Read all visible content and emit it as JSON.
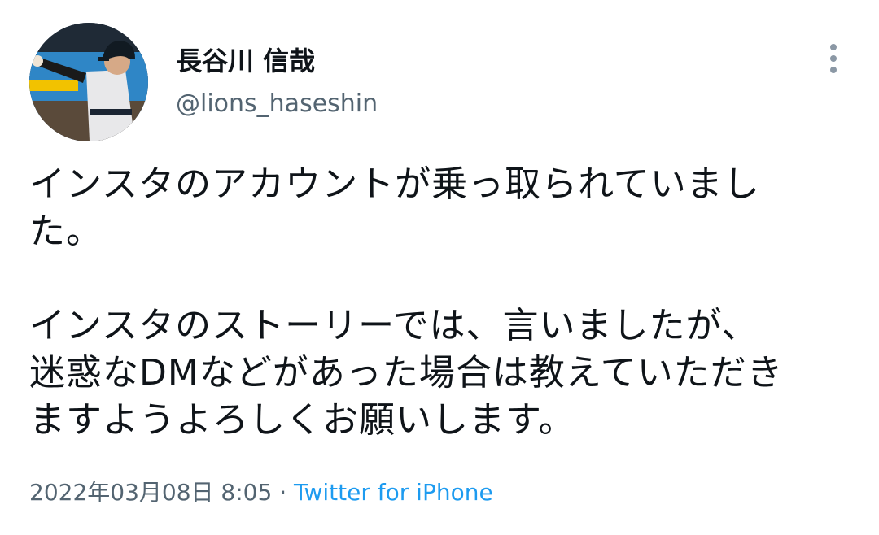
{
  "author": {
    "display_name": "長谷川 信哉",
    "handle": "@lions_haseshin"
  },
  "tweet": {
    "paragraph_1_line_1": "インスタのアカウントが乗っ取られていまし",
    "paragraph_1_line_2": "た。",
    "paragraph_2_line_1": "インスタのストーリーでは、言いましたが、",
    "paragraph_2_line_2": "迷惑なDMなどがあった場合は教えていただき",
    "paragraph_2_line_3": "ますようよろしくお願いします。"
  },
  "meta": {
    "timestamp": "2022年03月08日 8:05",
    "separator": "·",
    "source": "Twitter for iPhone"
  },
  "icons": {
    "more": "more-vertical-icon",
    "avatar": "avatar"
  },
  "colors": {
    "text": "#0f1419",
    "secondary": "#536471",
    "link": "#1d9bf0"
  }
}
